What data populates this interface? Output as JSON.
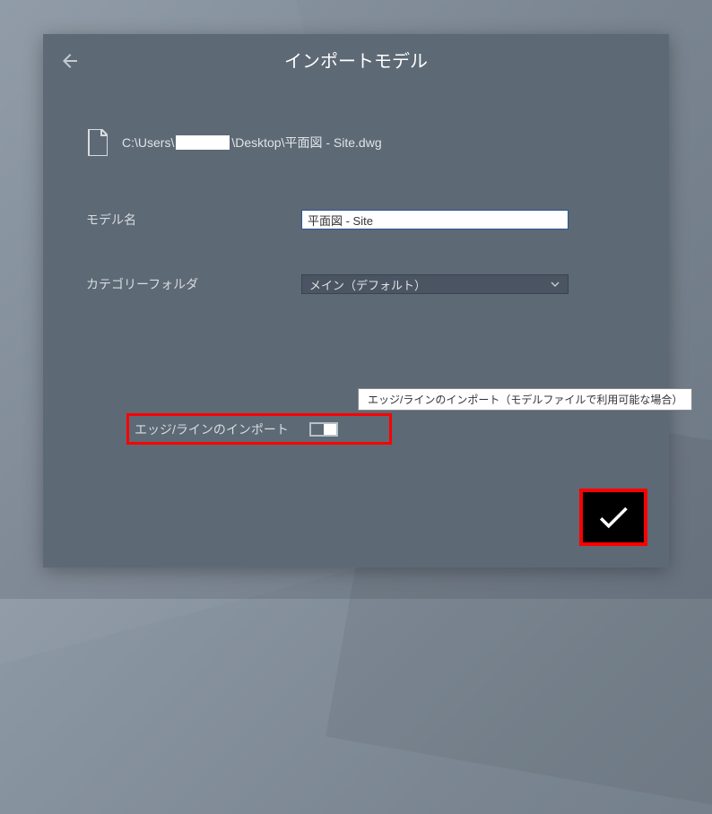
{
  "header": {
    "title": "インポートモデル"
  },
  "file": {
    "path_prefix": "C:\\Users\\",
    "path_suffix": "\\Desktop\\平面図 - Site.dwg"
  },
  "form": {
    "model_name_label": "モデル名",
    "model_name_value": "平面図 - Site",
    "category_label": "カテゴリーフォルダ",
    "category_value": "メイン（デフォルト）",
    "edge_import_label": "エッジ/ラインのインポート",
    "edge_import_enabled": true
  },
  "tooltip": {
    "text": "エッジ/ラインのインポート（モデルファイルで利用可能な場合）"
  }
}
